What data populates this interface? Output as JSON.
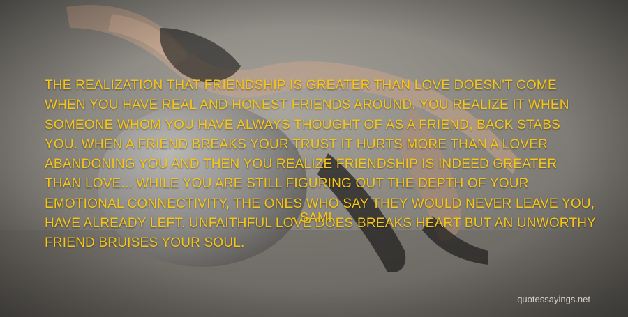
{
  "quote": {
    "text": "THE REALIZATION THAT FRIENDSHIP IS GREATER THAN LOVE DOESN'T COME WHEN YOU HAVE REAL AND HONEST FRIENDS AROUND. YOU REALIZE IT WHEN SOMEONE WHOM YOU HAVE ALWAYS THOUGHT OF AS A FRIEND, BACK STABS YOU. WHEN A FRIEND BREAKS YOUR TRUST IT HURTS MORE THAN A LOVER ABANDONING YOU AND THEN YOU REALIZE FRIENDSHIP IS INDEED GREATER THAN LOVE... WHILE YOU ARE STILL FIGURING OUT THE DEPTH OF YOUR EMOTIONAL CONNECTIVITY, THE ONES WHO SAY THEY WOULD NEVER LEAVE YOU, HAVE ALREADY LEFT. UNFAITHFUL LOVE DOES BREAKS HEART BUT AN UNWORTHY FRIEND BRUISES YOUR SOUL.",
    "author": "- SAMI"
  },
  "watermark": "quotessayings.net",
  "colors": {
    "quote_text": "#f5c518",
    "background": "#8a8680",
    "watermark": "#e8e6e2"
  }
}
